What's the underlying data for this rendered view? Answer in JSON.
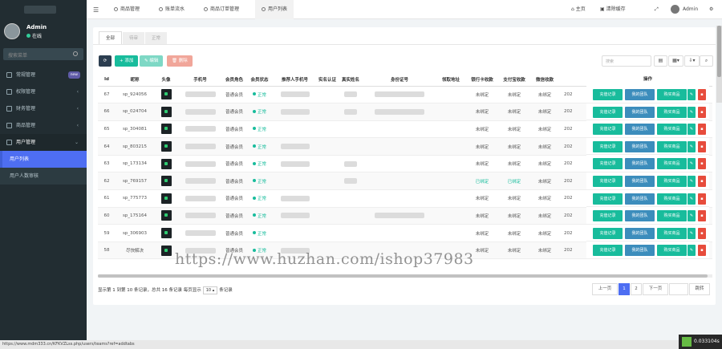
{
  "sidebar": {
    "user": {
      "name": "Admin",
      "status": "在线"
    },
    "search_placeholder": "搜索菜单",
    "items": [
      {
        "label": "常规管理",
        "badge": "new"
      },
      {
        "label": "权限管理",
        "caret": "‹"
      },
      {
        "label": "财务管理",
        "caret": "‹"
      },
      {
        "label": "商品管理",
        "caret": "‹"
      },
      {
        "label": "用户管理",
        "caret": "⌄"
      },
      {
        "label": "用户列表"
      },
      {
        "label": "用户人数审核"
      }
    ]
  },
  "topbar": {
    "tabs": [
      "商品管理",
      "账单流水",
      "商品订单管理",
      "用户列表"
    ],
    "right": {
      "home": "主页",
      "clear": "清除缓存",
      "user": "Admin"
    }
  },
  "panel": {
    "tabs": [
      "全部",
      "待审",
      "正常"
    ],
    "toolbar": {
      "add": "+ 添加",
      "edit": "✎ 编辑",
      "del": "🗑 删除",
      "search_placeholder": "搜索"
    },
    "columns": [
      "Id",
      "昵称",
      "头像",
      "手机号",
      "会员角色",
      "会员状态",
      "推荐人手机号",
      "实名认证",
      "真实姓名",
      "身份证号",
      "领取地址",
      "银行卡收款",
      "支付宝收款",
      "微信收款",
      ""
    ],
    "ops_header": "操作",
    "rows": [
      {
        "id": "67",
        "nick": "sp_924056",
        "phone": "",
        "role": "普通会员",
        "status": "正常",
        "ref": "",
        "real": "",
        "idc": "",
        "addr": "",
        "bank": "未绑定",
        "ali": "未绑定",
        "wx": "未绑定",
        "t": "202"
      },
      {
        "id": "66",
        "nick": "sp_024704",
        "phone": "",
        "role": "普通会员",
        "status": "正常",
        "ref": "",
        "real": "",
        "idc": "",
        "addr": "",
        "bank": "未绑定",
        "ali": "未绑定",
        "wx": "未绑定",
        "t": "202"
      },
      {
        "id": "65",
        "nick": "sp_304081",
        "phone": "",
        "role": "普通会员",
        "status": "正常",
        "ref": "",
        "real": "",
        "idc": "",
        "addr": "",
        "bank": "未绑定",
        "ali": "未绑定",
        "wx": "未绑定",
        "t": "202"
      },
      {
        "id": "64",
        "nick": "sp_803215",
        "phone": "",
        "role": "普通会员",
        "status": "正常",
        "ref": "",
        "real": "",
        "idc": "",
        "addr": "",
        "bank": "未绑定",
        "ali": "未绑定",
        "wx": "未绑定",
        "t": "202"
      },
      {
        "id": "63",
        "nick": "sp_173134",
        "phone": "",
        "role": "普通会员",
        "status": "正常",
        "ref": "",
        "real": "",
        "idc": "",
        "addr": "",
        "bank": "未绑定",
        "ali": "未绑定",
        "wx": "未绑定",
        "t": "202"
      },
      {
        "id": "62",
        "nick": "sp_769157",
        "phone": "",
        "role": "普通会员",
        "status": "正常",
        "ref": "",
        "real": "",
        "idc": "",
        "addr": "",
        "bank": "已绑定",
        "ali": "已绑定",
        "wx": "未绑定",
        "t": "202"
      },
      {
        "id": "61",
        "nick": "sp_775773",
        "phone": "",
        "role": "普通会员",
        "status": "正常",
        "ref": "",
        "real": "",
        "idc": "",
        "addr": "",
        "bank": "未绑定",
        "ali": "未绑定",
        "wx": "未绑定",
        "t": "202"
      },
      {
        "id": "60",
        "nick": "sp_175164",
        "phone": "",
        "role": "普通会员",
        "status": "正常",
        "ref": "",
        "real": "",
        "idc": "",
        "addr": "",
        "bank": "未绑定",
        "ali": "未绑定",
        "wx": "未绑定",
        "t": "202"
      },
      {
        "id": "59",
        "nick": "sp_306903",
        "phone": "",
        "role": "普通会员",
        "status": "正常",
        "ref": "",
        "real": "",
        "idc": "",
        "addr": "",
        "bank": "未绑定",
        "ali": "未绑定",
        "wx": "未绑定",
        "t": "202"
      },
      {
        "id": "58",
        "nick": "尽快解决",
        "phone": "",
        "role": "普通会员",
        "status": "正常",
        "ref": "",
        "real": "",
        "idc": "",
        "addr": "",
        "bank": "未绑定",
        "ali": "未绑定",
        "wx": "未绑定",
        "t": "202"
      }
    ],
    "op_buttons": [
      "充值记录",
      "我的团队",
      "购买商品"
    ],
    "footer": {
      "info": "显示第 1 到第 10 条记录，总共 16 条记录 每页显示",
      "per": "10 ▴",
      "suffix": "条记录"
    },
    "pager": {
      "prev": "上一页",
      "p1": "1",
      "p2": "2",
      "next": "下一页",
      "go": "跳转"
    }
  },
  "statusbar": {
    "url": "https://www.mdm333.cn/KFKVZLss.php/users/teams?ref=addtabs",
    "perf": "0.033104s"
  },
  "watermark": "https://www.huzhan.com/ishop37983"
}
